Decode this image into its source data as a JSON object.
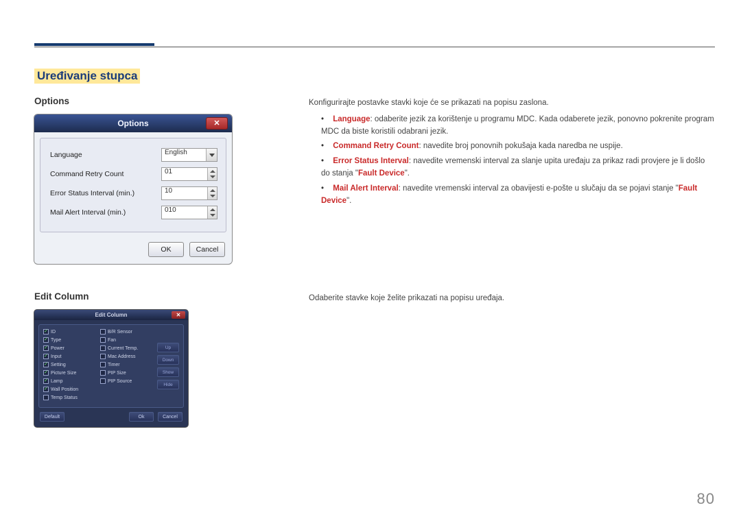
{
  "page_number": "80",
  "section_title": "Uređivanje stupca",
  "options": {
    "heading": "Options",
    "intro": "Konfigurirajte postavke stavki koje će se prikazati na popisu zaslona.",
    "dialog": {
      "title": "Options",
      "rows": {
        "language_label": "Language",
        "language_value": "English",
        "retry_label": "Command Retry Count",
        "retry_value": "01",
        "error_label": "Error Status Interval (min.)",
        "error_value": "10",
        "mail_label": "Mail Alert Interval (min.)",
        "mail_value": "010"
      },
      "ok": "OK",
      "cancel": "Cancel"
    },
    "bullets": {
      "b1_kw": "Language",
      "b1_txt": ": odaberite jezik za korištenje u programu MDC. Kada odaberete jezik, ponovno pokrenite program MDC da biste koristili odabrani jezik.",
      "b2_kw": "Command Retry Count",
      "b2_txt": ": navedite broj ponovnih pokušaja kada naredba ne uspije.",
      "b3_kw": "Error Status Interval",
      "b3_txt_a": ": navedite vremenski interval za slanje upita uređaju za prikaz radi provjere je li došlo do stanja \"",
      "b3_kw2": "Fault Device",
      "b3_txt_b": "\".",
      "b4_kw": "Mail Alert Interval",
      "b4_txt_a": ": navedite vremenski interval za obavijesti e-pošte u slučaju da se pojavi stanje \"",
      "b4_kw2": "Fault Device",
      "b4_txt_b": "\"."
    }
  },
  "edit_column": {
    "heading": "Edit Column",
    "intro": "Odaberite stavke koje želite prikazati na popisu uređaja.",
    "dialog_title": "Edit Column",
    "col1": [
      {
        "label": "ID",
        "on": true
      },
      {
        "label": "Type",
        "on": true
      },
      {
        "label": "Power",
        "on": true
      },
      {
        "label": "Input",
        "on": true
      },
      {
        "label": "Setting",
        "on": true
      },
      {
        "label": "Picture Size",
        "on": true
      },
      {
        "label": "Lamp",
        "on": true
      },
      {
        "label": "Wall Position",
        "on": true
      },
      {
        "label": "Temp Status",
        "on": false
      }
    ],
    "col2": [
      {
        "label": "B/R Sensor",
        "on": false
      },
      {
        "label": "Fan",
        "on": false
      },
      {
        "label": "Current Temp.",
        "on": false
      },
      {
        "label": "Mac Address",
        "on": false
      },
      {
        "label": "Timer",
        "on": false
      },
      {
        "label": "PIP Size",
        "on": false
      },
      {
        "label": "PIP Source",
        "on": false
      }
    ],
    "side_btns": {
      "up": "Up",
      "down": "Down",
      "show": "Show",
      "hide": "Hide"
    },
    "footer": {
      "default": "Default",
      "ok": "Ok",
      "cancel": "Cancel"
    }
  }
}
